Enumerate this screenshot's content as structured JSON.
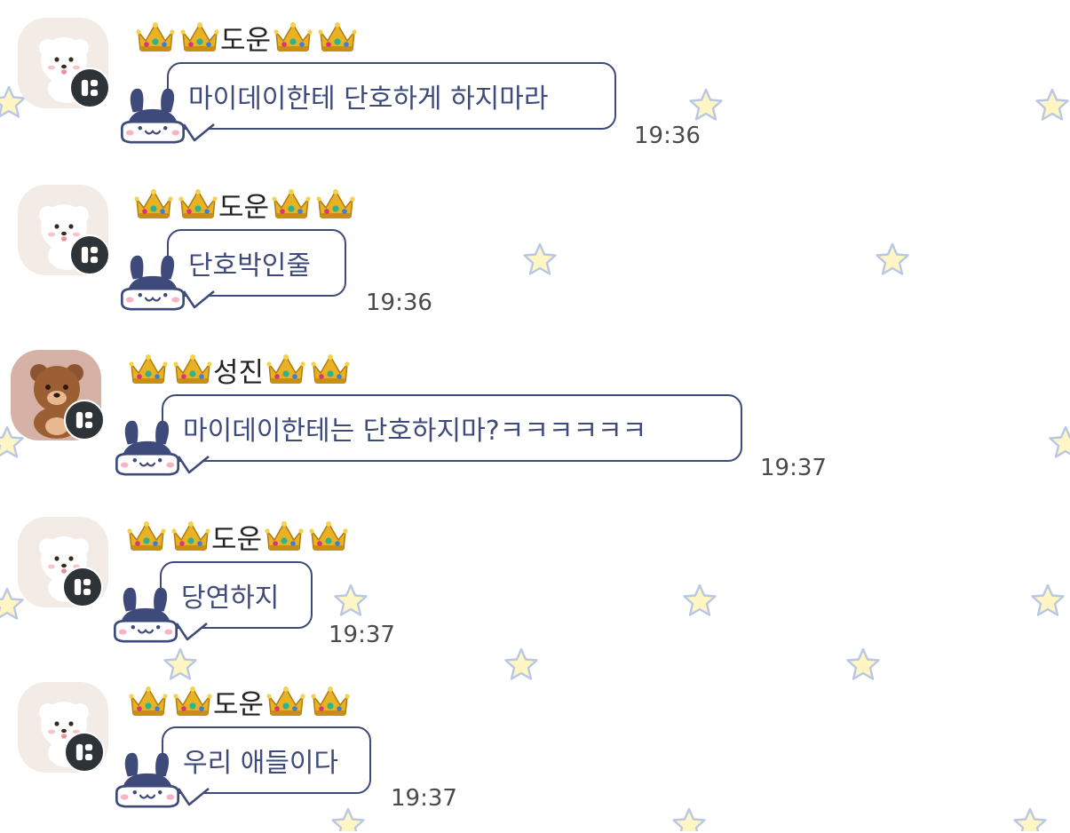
{
  "messages": [
    {
      "sender": "도운",
      "text": "마이데이한테 단호하게 하지마라",
      "time": "19:36",
      "avatar": "white-puppy-icon"
    },
    {
      "sender": "도운",
      "text": "단호박인줄",
      "time": "19:36",
      "avatar": "white-puppy-icon"
    },
    {
      "sender": "성진",
      "text": "마이데이한테는 단호하지마?ㅋㅋㅋㅋㅋㅋ",
      "time": "19:37",
      "avatar": "brown-bear-icon"
    },
    {
      "sender": "도운",
      "text": "당연하지",
      "time": "19:37",
      "avatar": "white-puppy-icon"
    },
    {
      "sender": "도운",
      "text": "우리 애들이다",
      "time": "19:37",
      "avatar": "white-puppy-icon"
    }
  ],
  "icons": {
    "crown": "crown-icon",
    "badge": "app-badge-icon",
    "bubble_decoration": "bunny-sticker-icon",
    "background": "star-icon"
  },
  "colors": {
    "bubble_border": "#3d4a7a",
    "bubble_text": "#3d4a7a",
    "badge": "#2e3338",
    "crown_gold": "#e0a21a",
    "star_fill": "#fff6c4",
    "star_stroke": "#b9c7e6"
  }
}
